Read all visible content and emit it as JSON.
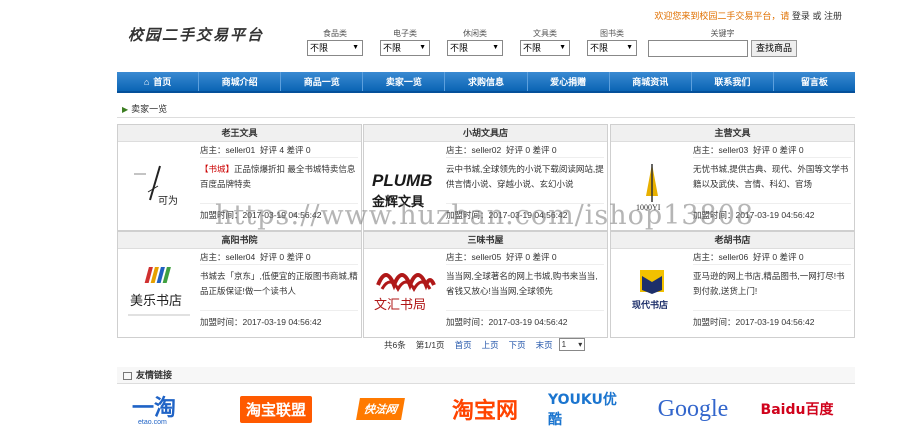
{
  "header": {
    "logo_text": "校园二手交易平台",
    "welcome": "欢迎您来到校园二手交易平台，请",
    "login": "登录",
    "or": "或",
    "register": "注册"
  },
  "filters": [
    {
      "label": "食品类",
      "value": "不限"
    },
    {
      "label": "电子类",
      "value": "不限"
    },
    {
      "label": "休闲类",
      "value": "不限"
    },
    {
      "label": "文具类",
      "value": "不限"
    },
    {
      "label": "图书类",
      "value": "不限"
    }
  ],
  "search": {
    "label": "关键字",
    "button": "查找商品"
  },
  "nav": [
    "首页",
    "商城介绍",
    "商品一览",
    "卖家一览",
    "求购信息",
    "爱心捐赠",
    "商城资讯",
    "联系我们",
    "留言板"
  ],
  "section_title": "卖家一览",
  "sellers": [
    {
      "name": "老王文具",
      "owner": "店主：seller01",
      "rating": "好评 4 差评 0",
      "desc_hl": "【书城】",
      "desc": "正品惊爆折扣 最全书城特卖信息 百度品牌特卖",
      "joined": "加盟时间：2017-03-19 04:56:42",
      "logo_text": "可为"
    },
    {
      "name": "小胡文具店",
      "owner": "店主：seller02",
      "rating": "好评 0 差评 0",
      "desc_hl": "",
      "desc": "云中书城,全球领先的小说下载阅读网站,提供言情小说、穿越小说、玄幻小说",
      "joined": "加盟时间：2017-03-19 04:56:42",
      "logo_text": "金辉文具"
    },
    {
      "name": "主营文具",
      "owner": "店主：seller03",
      "rating": "好评 0 差评 0",
      "desc_hl": "",
      "desc": "无忧书城,提供古典、现代、外国等文学书籍以及武侠、言情、科幻、官场",
      "joined": "加盟时间：2017-03-19 04:56:42",
      "logo_text": "1000YI"
    },
    {
      "name": "高阳书院",
      "owner": "店主：seller04",
      "rating": "好评 0 差评 0",
      "desc_hl": "",
      "desc": "书城去「京东」,低便宜的正版图书商城,精品正版保证!做一个读书人",
      "joined": "加盟时间：2017-03-19 04:56:42",
      "logo_text": "美乐书店"
    },
    {
      "name": "三味书屋",
      "owner": "店主：seller05",
      "rating": "好评 0 差评 0",
      "desc_hl": "",
      "desc": "当当网,全球著名的网上书城,购书来当当,省钱又放心!当当网,全球领先",
      "joined": "加盟时间：2017-03-19 04:56:42",
      "logo_text": "文汇书局"
    },
    {
      "name": "老胡书店",
      "owner": "店主：seller06",
      "rating": "好评 0 差评 0",
      "desc_hl": "",
      "desc": "亚马逊的网上书店,精品图书,一网打尽!书到付款,送货上门!",
      "joined": "加盟时间：2017-03-19 04:56:42",
      "logo_text": "现代书店"
    }
  ],
  "pager": {
    "total": "共6条",
    "page": "第1/1页",
    "first": "首页",
    "prev": "上页",
    "next": "下页",
    "last": "末页",
    "select": "1"
  },
  "links_title": "友情链接",
  "friend_links": [
    "一淘",
    "淘宝联盟",
    "快法网",
    "淘宝网",
    "YOUKU优酷",
    "Google",
    "Baidu百度"
  ],
  "watermark": "https://www.huzhan.com/ishop13808",
  "colors": {
    "nav_bg": "#0a64b4",
    "accent_orange": "#e07000",
    "green_tri": "#3b7d20"
  }
}
